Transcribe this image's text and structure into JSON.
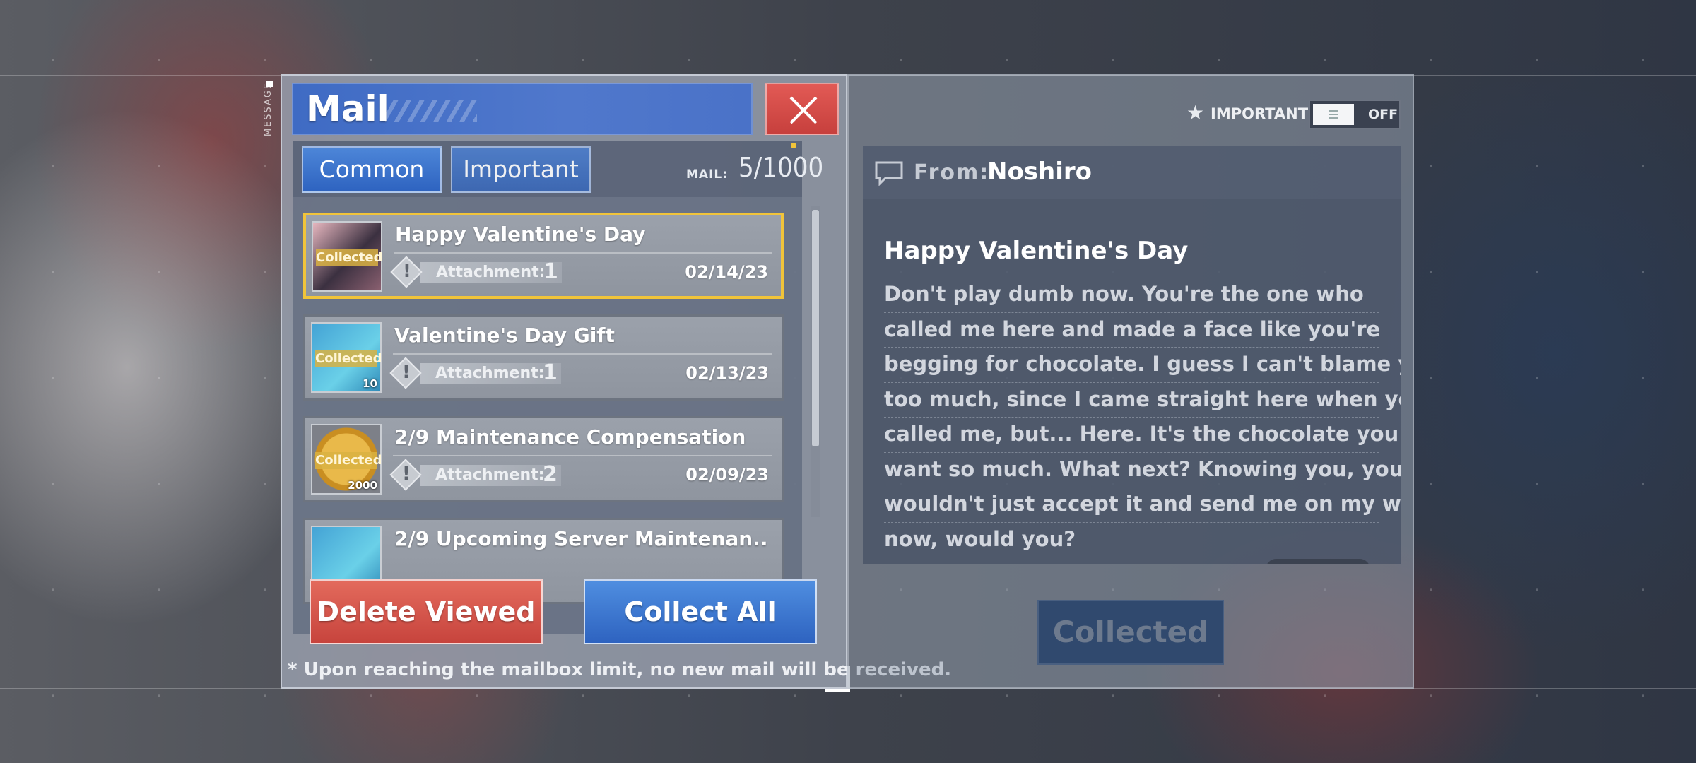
{
  "side_tag": "MESSAGE",
  "mail": {
    "title": "Mail",
    "tabs": [
      {
        "label": "Common",
        "active": true
      },
      {
        "label": "Important",
        "active": false
      }
    ],
    "count_label": "MAIL:",
    "count_value": "5/1000",
    "items": [
      {
        "title": "Happy Valentine's Day",
        "badge": "Collected",
        "attachment_label": "Attachment:",
        "attachment_count": "1",
        "date": "02/14/23",
        "thumb": "portrait",
        "qty": "",
        "selected": true
      },
      {
        "title": "Valentine's Day Gift",
        "badge": "Collected",
        "attachment_label": "Attachment:",
        "attachment_count": "1",
        "date": "02/13/23",
        "thumb": "gift",
        "qty": "10",
        "selected": false
      },
      {
        "title": "2/9 Maintenance Compensation",
        "badge": "Collected",
        "attachment_label": "Attachment:",
        "attachment_count": "2",
        "date": "02/09/23",
        "thumb": "coin",
        "qty": "2000",
        "selected": false
      },
      {
        "title": "2/9 Upcoming Server Maintenan..",
        "badge": "",
        "attachment_label": "",
        "attachment_count": "",
        "date": "",
        "thumb": "gift",
        "qty": "",
        "selected": false
      }
    ],
    "delete_label": "Delete Viewed",
    "collect_label": "Collect All",
    "footnote": "* Upon reaching the mailbox limit, no new mail will be received."
  },
  "detail": {
    "important_label": "IMPORTANT",
    "toggle_state": "OFF",
    "from_label": "From:",
    "from_value": "Noshiro",
    "title": "Happy Valentine's Day",
    "body_lines": [
      "Don't play dumb now. You're the one who",
      "called me here and made a face like you're",
      "begging for chocolate. I guess I can't blame you",
      "too much, since I came straight here when you",
      "called me, but... Here. It's the chocolate you",
      "want so much. What next? Knowing you, you",
      "wouldn't just accept it and send me on my way,",
      "now, would you?"
    ],
    "collected_label": "Collected"
  },
  "colors": {
    "accent_blue": "#2e63c0",
    "close_red": "#c7403d",
    "selected_gold": "#f1c43a"
  },
  "icons": [
    "close-icon",
    "star-icon",
    "chat-bubble-icon",
    "exclamation-icon"
  ]
}
